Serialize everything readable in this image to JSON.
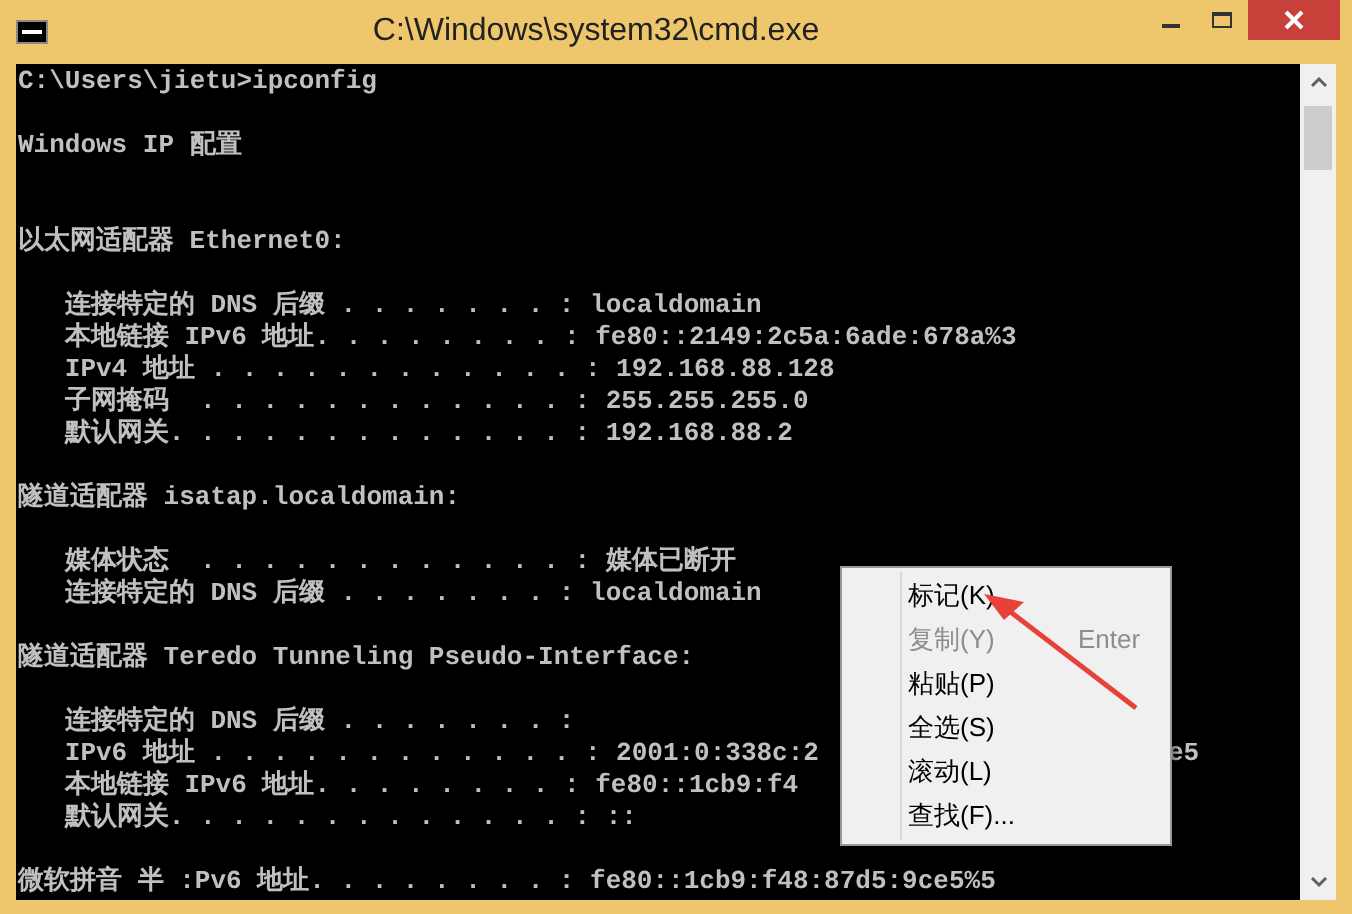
{
  "window": {
    "title": "C:\\Windows\\system32\\cmd.exe"
  },
  "console_lines": [
    {
      "kind": "text",
      "text": "C:\\Users\\jietu>ipconfig"
    },
    {
      "kind": "blank"
    },
    {
      "kind": "text",
      "text": "Windows IP 配置"
    },
    {
      "kind": "blank"
    },
    {
      "kind": "blank"
    },
    {
      "kind": "text",
      "text": "以太网适配器 Ethernet0:"
    },
    {
      "kind": "blank"
    },
    {
      "kind": "text",
      "text": "   连接特定的 DNS 后缀 . . . . . . . : localdomain"
    },
    {
      "kind": "text",
      "text": "   本地链接 IPv6 地址. . . . . . . . : fe80::2149:2c5a:6ade:678a%3"
    },
    {
      "kind": "text",
      "text": "   IPv4 地址 . . . . . . . . . . . . : 192.168.88.128"
    },
    {
      "kind": "text",
      "text": "   子网掩码  . . . . . . . . . . . . : 255.255.255.0"
    },
    {
      "kind": "text",
      "text": "   默认网关. . . . . . . . . . . . . : 192.168.88.2"
    },
    {
      "kind": "blank"
    },
    {
      "kind": "text",
      "text": "隧道适配器 isatap.localdomain:"
    },
    {
      "kind": "blank"
    },
    {
      "kind": "text",
      "text": "   媒体状态  . . . . . . . . . . . . : 媒体已断开"
    },
    {
      "kind": "text",
      "text": "   连接特定的 DNS 后缀 . . . . . . . : localdomain"
    },
    {
      "kind": "blank"
    },
    {
      "kind": "text",
      "text": "隧道适配器 Teredo Tunneling Pseudo-Interface:"
    },
    {
      "kind": "blank"
    },
    {
      "kind": "text",
      "text": "   连接特定的 DNS 后缀 . . . . . . . :"
    },
    {
      "kind": "text",
      "text": "   IPv6 地址 . . . . . . . . . . . . : 2001:0:338c:2",
      "tail": "e5"
    },
    {
      "kind": "text",
      "text": "   本地链接 IPv6 地址. . . . . . . . : fe80::1cb9:f4"
    },
    {
      "kind": "text",
      "text": "   默认网关. . . . . . . . . . . . . : ::"
    },
    {
      "kind": "blank"
    },
    {
      "kind": "text",
      "text": "微软拼音 半 :Pv6 地址. . . . . . . . : fe80::1cb9:f48:87d5:9ce5%5"
    }
  ],
  "context_menu": {
    "items": [
      {
        "label": "标记(K)",
        "disabled": false
      },
      {
        "label": "复制(Y)",
        "shortcut": "Enter",
        "disabled": true
      },
      {
        "label": "粘贴(P)",
        "disabled": false
      },
      {
        "label": "全选(S)",
        "disabled": false
      },
      {
        "label": "滚动(L)",
        "disabled": false
      },
      {
        "label": "查找(F)...",
        "disabled": false
      }
    ]
  }
}
